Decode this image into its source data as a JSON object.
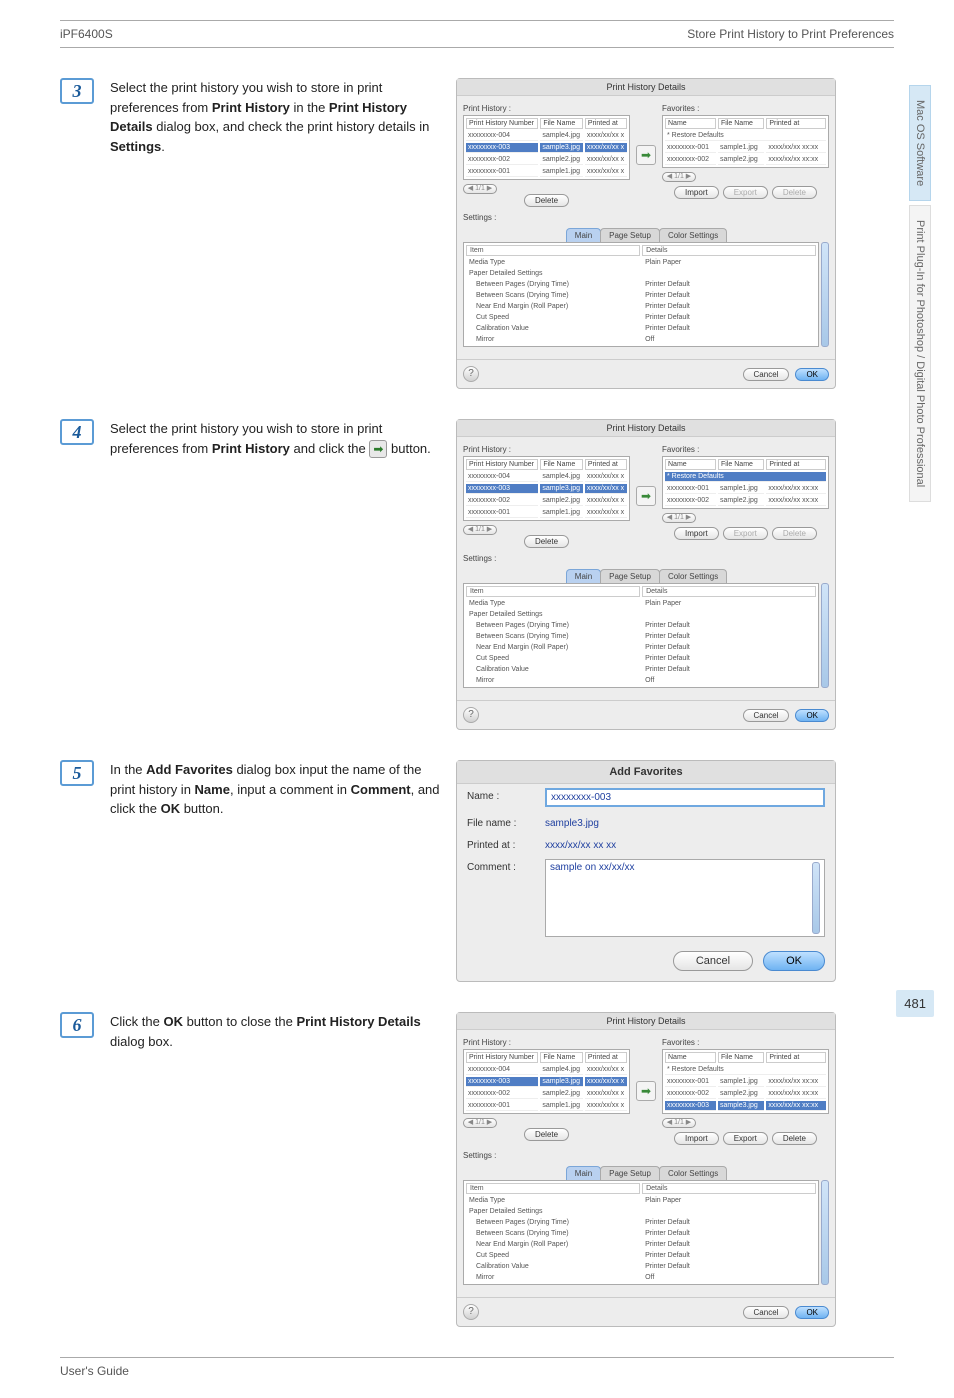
{
  "header": {
    "left": "iPF6400S",
    "right": "Store Print History to Print Preferences"
  },
  "sidebar": {
    "tab1": "Mac OS Software",
    "tab2": "Print Plug-In for Photoshop / Digital Photo Professional"
  },
  "page_number": "481",
  "footer": "User's Guide",
  "steps": {
    "s3": {
      "num": "3",
      "t1": "Select the print history you wish to store in print preferences from ",
      "b1": "Print History",
      "t2": " in the ",
      "b2": "Print History Details",
      "t3": " dialog box, and check the print history details in ",
      "b3": "Settings",
      "t4": "."
    },
    "s4": {
      "num": "4",
      "t1": "Select the print history you wish to store in print preferences from ",
      "b1": "Print History",
      "t2": " and click the ",
      "t3": " button."
    },
    "s5": {
      "num": "5",
      "t1": "In the ",
      "b1": "Add Favorites",
      "t2": " dialog box input the name of the print history in ",
      "b2": "Name",
      "t3": ", input a comment in ",
      "b3": "Comment",
      "t4": ", and click the ",
      "b4": "OK",
      "t5": " button."
    },
    "s6": {
      "num": "6",
      "t1": "Click the ",
      "b1": "OK",
      "t2": " button to close the ",
      "b2": "Print History Details",
      "t3": " dialog box."
    }
  },
  "dlg": {
    "title": "Print History Details",
    "ph_label": "Print History :",
    "fav_label": "Favorites :",
    "settings_label": "Settings :",
    "cols": {
      "phnum": "Print History Number",
      "fname": "File Name",
      "printed": "Printed at",
      "name": "Name"
    },
    "history_rows": [
      {
        "n": "xxxxxxxx-004",
        "f": "sample4.jpg",
        "p": "xxxx/xx/xx x"
      },
      {
        "n": "xxxxxxxx-003",
        "f": "sample3.jpg",
        "p": "xxxx/xx/xx x"
      },
      {
        "n": "xxxxxxxx-002",
        "f": "sample2.jpg",
        "p": "xxxx/xx/xx x"
      },
      {
        "n": "xxxxxxxx-001",
        "f": "sample1.jpg",
        "p": "xxxx/xx/xx x"
      }
    ],
    "fav_restore": "* Restore Defaults",
    "fav_rows_2": [
      {
        "n": "xxxxxxxx-001",
        "f": "sample1.jpg",
        "p": "xxxx/xx/xx xx:xx"
      },
      {
        "n": "xxxxxxxx-002",
        "f": "sample2.jpg",
        "p": "xxxx/xx/xx xx:xx"
      }
    ],
    "fav_rows_3": [
      {
        "n": "xxxxxxxx-001",
        "f": "sample1.jpg",
        "p": "xxxx/xx/xx xx:xx"
      },
      {
        "n": "xxxxxxxx-002",
        "f": "sample2.jpg",
        "p": "xxxx/xx/xx xx:xx"
      },
      {
        "n": "xxxxxxxx-003",
        "f": "sample3.jpg",
        "p": "xxxx/xx/xx xx:xx"
      }
    ],
    "buttons": {
      "delete": "Delete",
      "import": "Import",
      "export": "Export",
      "cancel": "Cancel",
      "ok": "OK"
    },
    "tabs": {
      "main": "Main",
      "page": "Page Setup",
      "color": "Color Settings"
    },
    "settings_cols": {
      "item": "Item",
      "details": "Details"
    },
    "settings_rows": [
      {
        "i": "Media Type",
        "d": "Plain Paper"
      },
      {
        "i": "Paper Detailed Settings",
        "d": ""
      },
      {
        "i": "Between Pages (Drying Time)",
        "d": "Printer Default",
        "indent": true
      },
      {
        "i": "Between Scans (Drying Time)",
        "d": "Printer Default",
        "indent": true
      },
      {
        "i": "Near End Margin (Roll Paper)",
        "d": "Printer Default",
        "indent": true
      },
      {
        "i": "Cut Speed",
        "d": "Printer Default",
        "indent": true
      },
      {
        "i": "Calibration Value",
        "d": "Printer Default",
        "indent": true
      },
      {
        "i": "Mirror",
        "d": "Off",
        "indent": true
      }
    ],
    "pager": "1/1"
  },
  "addfav": {
    "title": "Add Favorites",
    "name_label": "Name :",
    "name_value": "xxxxxxxx-003",
    "file_label": "File name :",
    "file_value": "sample3.jpg",
    "printed_label": "Printed at :",
    "printed_value": "xxxx/xx/xx  xx xx",
    "comment_label": "Comment :",
    "comment_value": "sample on xx/xx/xx",
    "cancel": "Cancel",
    "ok": "OK"
  }
}
